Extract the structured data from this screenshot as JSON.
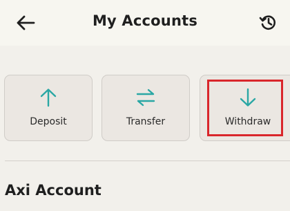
{
  "header": {
    "title": "My Accounts",
    "back_icon": "arrow-left-icon",
    "history_icon": "history-icon"
  },
  "actions": [
    {
      "label": "Deposit",
      "icon": "arrow-up-icon"
    },
    {
      "label": "Transfer",
      "icon": "swap-arrows-icon"
    },
    {
      "label": "Withdraw",
      "icon": "arrow-down-icon",
      "highlighted": true
    }
  ],
  "section": {
    "title": "Axi Account"
  },
  "colors": {
    "accent": "#2aa7a4",
    "highlight": "#d9262b",
    "background": "#f2f0eb",
    "card": "#ebe7e2"
  }
}
